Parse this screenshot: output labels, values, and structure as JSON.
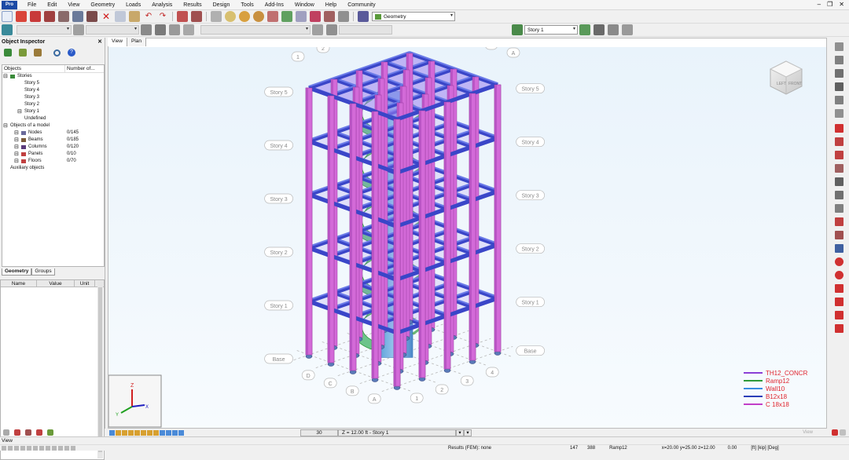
{
  "menu": {
    "logo": "Pro",
    "items": [
      "File",
      "Edit",
      "View",
      "Geometry",
      "Loads",
      "Analysis",
      "Results",
      "Design",
      "Tools",
      "Add-Ins",
      "Window",
      "Help",
      "Community"
    ]
  },
  "toolbar": {
    "layout_combo": "Geometry",
    "story_combo": "Story 1"
  },
  "object_inspector": {
    "title": "Object Inspector",
    "col_objects": "Objects",
    "col_number": "Number of...",
    "stories_label": "Stories",
    "stories": [
      "Story 5",
      "Story 4",
      "Story 3",
      "Story 2",
      "Story 1"
    ],
    "undefined_label": "Undefined",
    "model_label": "Objects of a model",
    "model_items": [
      {
        "name": "Nodes",
        "count": "0/145"
      },
      {
        "name": "Beams",
        "count": "0/185"
      },
      {
        "name": "Columns",
        "count": "0/120"
      },
      {
        "name": "Panels",
        "count": "0/10"
      },
      {
        "name": "Floors",
        "count": "0/70"
      }
    ],
    "auxiliary_label": "Auxiliary objects",
    "tab_geometry": "Geometry",
    "tab_groups": "Groups",
    "prop_name": "Name",
    "prop_value": "Value",
    "prop_unit": "Unit"
  },
  "view": {
    "tab_view": "View",
    "tab_plan": "Plan",
    "cube_left": "LEFT",
    "cube_front": "FRONT",
    "story_labels": [
      "Story 5",
      "Story 4",
      "Story 3",
      "Story 2",
      "Story 1",
      "Base"
    ],
    "grid_letters": [
      "A",
      "B",
      "C",
      "D"
    ],
    "grid_numbers": [
      "1",
      "2",
      "3",
      "4"
    ]
  },
  "legend": [
    {
      "label": "TH12_CONCR",
      "color": "#8b3fd6"
    },
    {
      "label": "Ramp12",
      "color": "#2e9a3a"
    },
    {
      "label": "Wall10",
      "color": "#3a8ce0"
    },
    {
      "label": "B12x18",
      "color": "#2a3fb8"
    },
    {
      "label": "C 18x18",
      "color": "#c23fc8"
    }
  ],
  "bottom": {
    "scale_value": "30",
    "level_text": "Z = 12.00 ft - Story 1",
    "view_label": "View"
  },
  "status": {
    "view_word": "View",
    "results": "Results (FEM): none",
    "num1": "147",
    "num2": "388",
    "section": "Ramp12",
    "coords": "x=20.00  y=25.00  z=12.00",
    "angle": "0.00",
    "units": "[ft] [kip] [Deg]"
  }
}
